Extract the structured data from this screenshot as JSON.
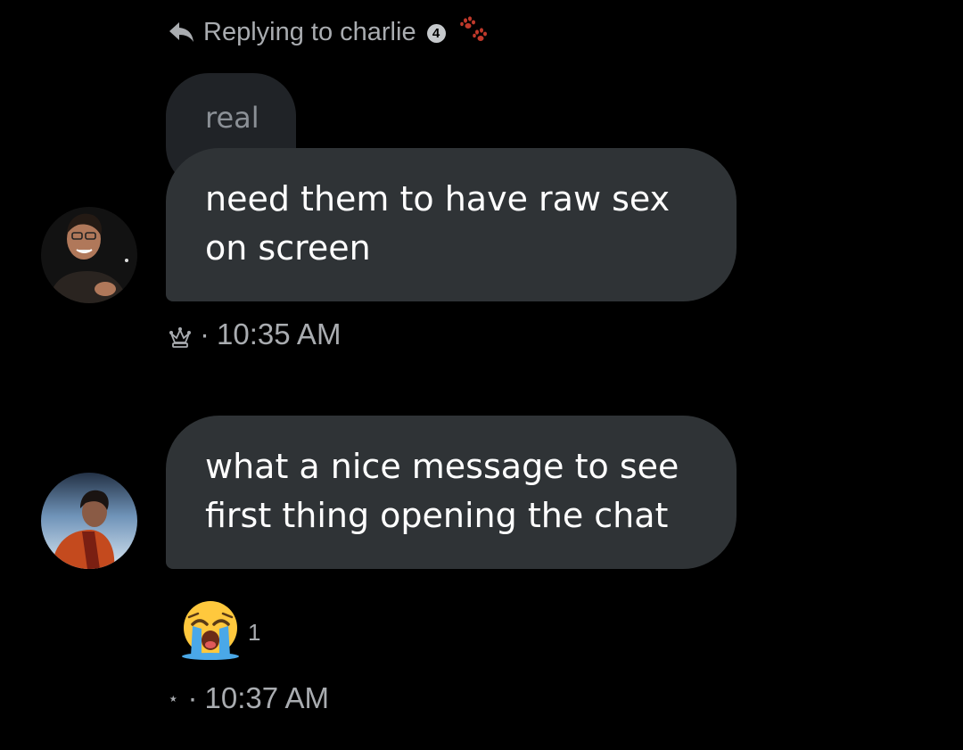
{
  "reply_header": {
    "prefix": "Replying to charlie",
    "badge": "4",
    "arrow_icon": "reply-arrow-icon",
    "paw_icon": "paw-prints-icon",
    "paw_color": "#c0392b"
  },
  "quoted_message": {
    "text": "real"
  },
  "messages": [
    {
      "text": "need them to have raw sex on screen",
      "status_icon": "crown-icon",
      "separator": "·",
      "time": "10:35 AM"
    },
    {
      "text": "what a nice message to see first thing opening the chat",
      "reaction": {
        "emoji_icon": "loudly-crying-face-icon",
        "count": "1"
      },
      "status_icon": "star-icon",
      "status_glyph": "⋆",
      "separator": "·",
      "time": "10:37 AM"
    }
  ],
  "colors": {
    "background": "#000000",
    "bubble": "#2f3336",
    "quoted_bubble": "#202327",
    "text_primary": "#ffffff",
    "text_secondary": "#a9acb0"
  }
}
